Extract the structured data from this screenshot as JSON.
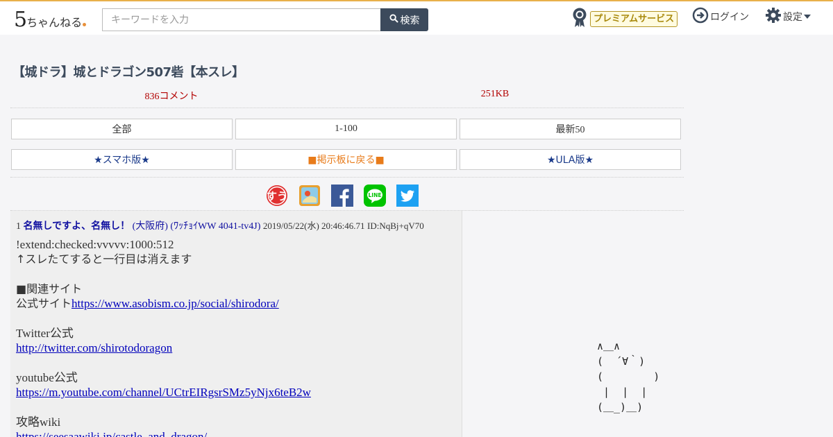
{
  "header": {
    "logo_number": "5",
    "logo_text": "ちゃんねる",
    "search_placeholder": "キーワードを入力",
    "search_button": "検索",
    "premium_label": "プレミアムサービス",
    "login_label": "ログイン",
    "settings_label": "設定"
  },
  "thread": {
    "title": "【城ドラ】城とドラゴン507砦【本スレ】",
    "comments": "836コメント",
    "size": "251KB"
  },
  "nav": {
    "all": "全部",
    "range": "1-100",
    "latest": "最新50",
    "smartphone": "★スマホ版★",
    "board_back": "■掲示板に戻る■",
    "ula": "★ULA版★"
  },
  "post": {
    "number": "1",
    "name": "名無しですよ、名無し！",
    "region": "(大阪府) (ﾜｯﾁｮｲWW 4041-tv4J)",
    "date": "2019/05/22(水) 20:46:46.71",
    "id": "ID:NqBj+qV70",
    "lines": {
      "l1": "!extend:checked:vvvvv:1000:512",
      "l2": "↑スレたてすると一行目は消えます",
      "l3": "■関連サイト",
      "l4_prefix": "公式サイト",
      "l4_link": "https://www.asobism.co.jp/social/shirodora/",
      "l5": "Twitter公式",
      "l6": "http://twitter.com/shirotodoragon",
      "l7": "youtube公式",
      "l8": "https://m.youtube.com/channel/UCtrEIRgsrSMz5yNjx6teB2w",
      "l9": "攻略wiki",
      "l10": "https://seesaawiki.jp/castle_and_dragon/"
    }
  },
  "ascii_art": "∧＿∧\n(  ´∀｀)\n(        )\n |  |  |\n(＿_)＿)",
  "icons": {
    "premium": "award-medal-icon",
    "login": "login-arrow-icon",
    "settings": "gear-icon",
    "search": "magnifier-icon",
    "share": [
      "hatena-icon",
      "bookmark-icon",
      "facebook-icon",
      "line-icon",
      "twitter-icon"
    ]
  },
  "colors": {
    "accent_dark": "#3c4a5c",
    "count_red": "#b20000",
    "premium_gold": "#a8890c",
    "link_blue": "#0000bb",
    "board_orange": "#e87b1a"
  }
}
